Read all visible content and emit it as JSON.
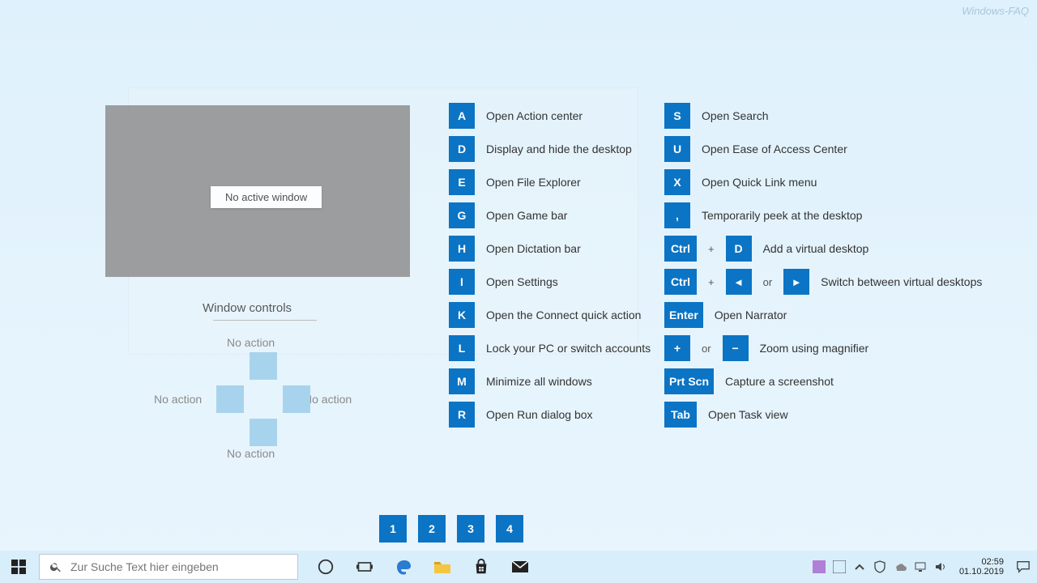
{
  "watermark": "Windows-FAQ",
  "overlay": {
    "no_active_window": "No active window",
    "window_controls_title": "Window controls",
    "no_action": "No action",
    "shortcuts_col1": [
      {
        "keys": [
          "A"
        ],
        "desc": "Open Action center"
      },
      {
        "keys": [
          "D"
        ],
        "desc": "Display and hide the desktop"
      },
      {
        "keys": [
          "E"
        ],
        "desc": "Open File Explorer"
      },
      {
        "keys": [
          "G"
        ],
        "desc": "Open Game bar"
      },
      {
        "keys": [
          "H"
        ],
        "desc": "Open Dictation bar"
      },
      {
        "keys": [
          "I"
        ],
        "desc": "Open Settings"
      },
      {
        "keys": [
          "K"
        ],
        "desc": "Open the Connect quick action"
      },
      {
        "keys": [
          "L"
        ],
        "desc": "Lock your PC or switch accounts"
      },
      {
        "keys": [
          "M"
        ],
        "desc": "Minimize all windows"
      },
      {
        "keys": [
          "R"
        ],
        "desc": "Open Run dialog box"
      }
    ],
    "shortcuts_col2": [
      {
        "keys": [
          "S"
        ],
        "desc": "Open Search"
      },
      {
        "keys": [
          "U"
        ],
        "desc": "Open Ease of Access Center"
      },
      {
        "keys": [
          "X"
        ],
        "desc": "Open Quick Link menu"
      },
      {
        "keys": [
          ","
        ],
        "desc": "Temporarily peek at the desktop"
      },
      {
        "keys": [
          "Ctrl",
          "+",
          "D"
        ],
        "desc": "Add a virtual desktop"
      },
      {
        "keys": [
          "Ctrl",
          "+",
          "◄",
          "or",
          "►"
        ],
        "desc": "Switch between virtual desktops"
      },
      {
        "keys": [
          "Enter"
        ],
        "desc": "Open Narrator",
        "wide": true
      },
      {
        "keys": [
          "+",
          "or",
          "−"
        ],
        "desc": "Zoom using magnifier",
        "zoom": true
      },
      {
        "keys": [
          "Prt Scn"
        ],
        "desc": "Capture a screenshot",
        "wide": true
      },
      {
        "keys": [
          "Tab"
        ],
        "desc": "Open Task view",
        "wide": true
      }
    ],
    "pages": [
      "1",
      "2",
      "3",
      "4"
    ]
  },
  "taskbar": {
    "search_placeholder": "Zur Suche Text hier eingeben",
    "time": "02:59",
    "date": "01.10.2019"
  }
}
